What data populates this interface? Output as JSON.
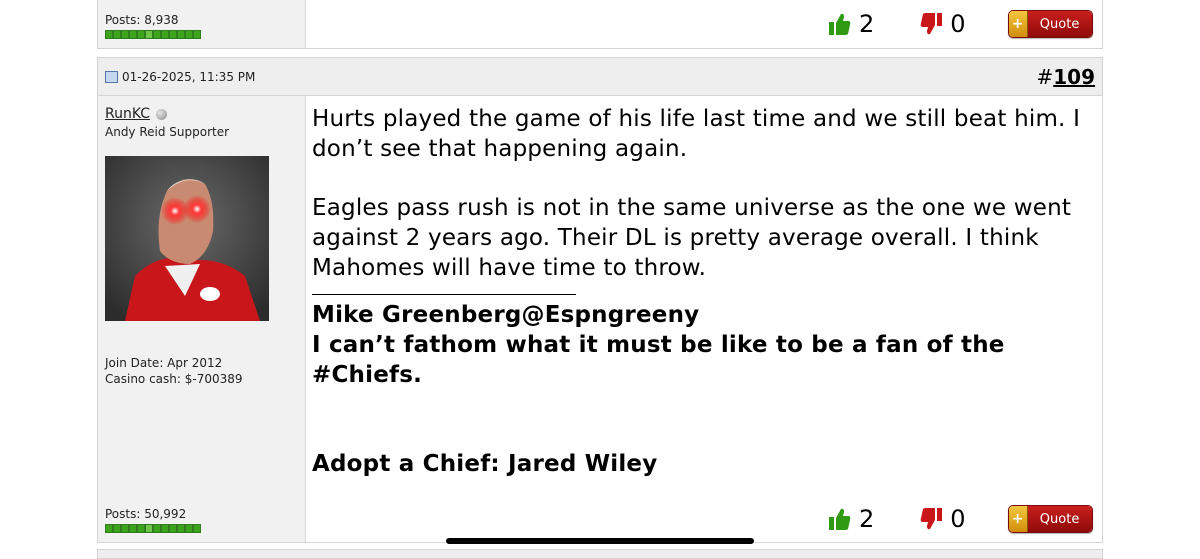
{
  "prev_post": {
    "posts_label": "Posts: 8,938",
    "thumbs_up_count": "2",
    "thumbs_down_count": "0",
    "quote_label": "Quote",
    "quote_plus": "+"
  },
  "post": {
    "date": "01-26-2025, 11:35 PM",
    "number_hash": "#",
    "number": "109",
    "username": "RunKC",
    "user_title": "Andy Reid Supporter",
    "join_date": "Join Date: Apr 2012",
    "casino_cash": "Casino cash: $-700389",
    "posts_label": "Posts: 50,992",
    "body": {
      "para1": "Hurts played the game of his life last time and we still beat him. I don’t see that happening again.",
      "para2": "Eagles pass rush is not in the same universe as the one we went against 2 years ago. Their DL is pretty average overall. I think Mahomes will have time to throw."
    },
    "signature": {
      "line1": "Mike Greenberg@Espngreeny",
      "line2": "I can’t fathom what it must be like to be a fan of the #Chiefs.",
      "line3": "Adopt a Chief: Jared Wiley"
    },
    "thumbs_up_count": "2",
    "thumbs_down_count": "0",
    "quote_label": "Quote",
    "quote_plus": "+"
  },
  "icons": {
    "thumbs_up": "thumbs-up-icon",
    "thumbs_down": "thumbs-down-icon",
    "post_icon": "post-icon",
    "online_status": "offline-status-icon"
  },
  "colors": {
    "thumb_up": "#2f9a12",
    "thumb_down": "#c8161b",
    "quote_red": "#b31614",
    "quote_gold": "#e8a91c"
  }
}
